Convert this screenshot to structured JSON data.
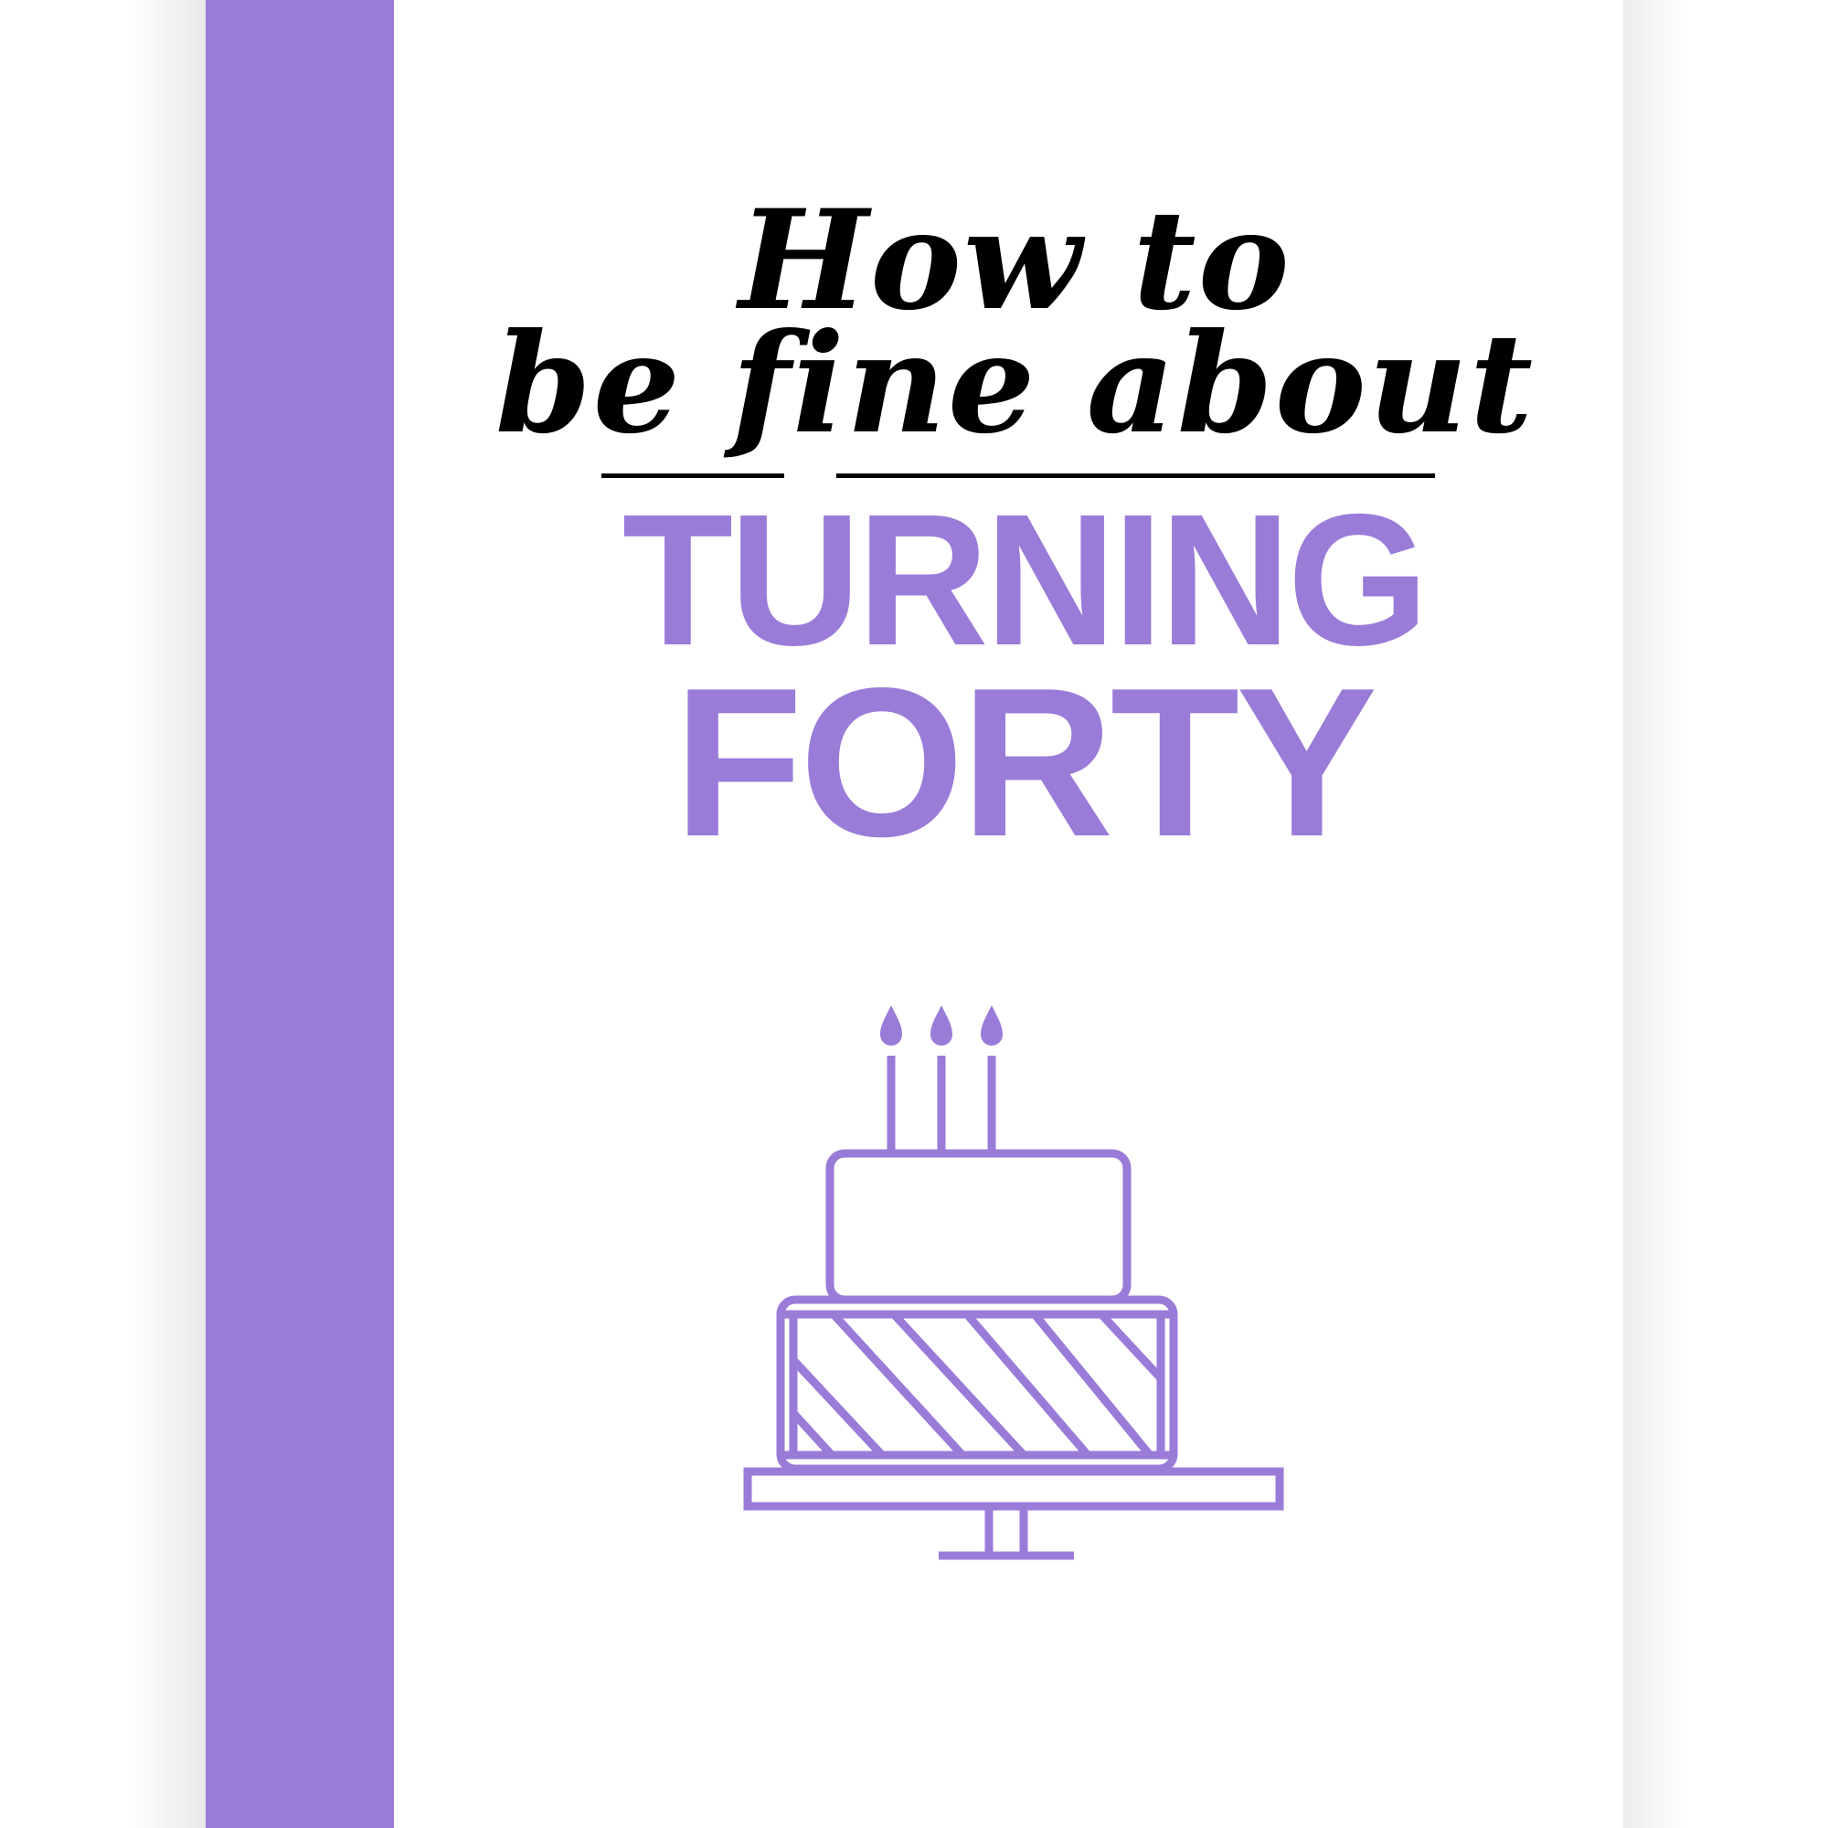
{
  "cover": {
    "title_script_line1": "How to",
    "title_script_line2": "be fine about",
    "title_main_line1": "TURNING",
    "title_main_line2": "FORTY"
  },
  "colors": {
    "accent": "#9a7bd8",
    "script_text": "#000000",
    "background": "#ffffff"
  },
  "illustration": {
    "icon": "birthday-cake-icon",
    "candles": 3,
    "tiers": 2
  }
}
